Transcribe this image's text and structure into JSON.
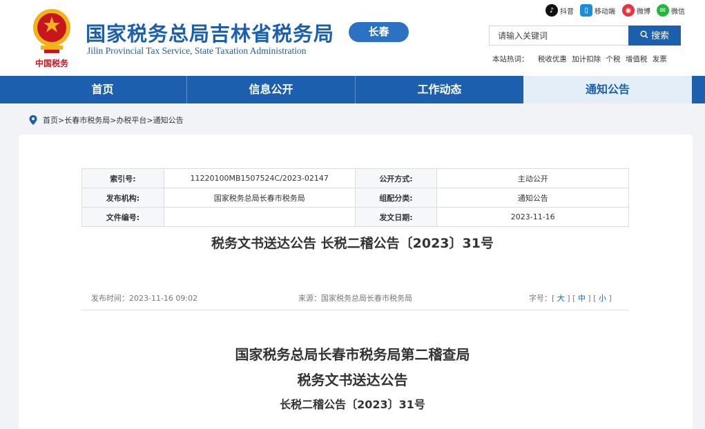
{
  "header": {
    "title": "国家税务总局吉林省税务局",
    "subtitle": "Jilin Provincial Tax Service, State Taxation Administration",
    "city_badge": "长春",
    "emblem_caption": "中国税务"
  },
  "social": [
    {
      "icon": "douyin-icon",
      "label": "抖音",
      "color": "#111111"
    },
    {
      "icon": "mobile-icon",
      "label": "移动端",
      "color": "#1a8fd8"
    },
    {
      "icon": "weibo-icon",
      "label": "微博",
      "color": "#e6333a"
    },
    {
      "icon": "wechat-icon",
      "label": "微信",
      "color": "#20b93b"
    }
  ],
  "search": {
    "placeholder": "请输入关键词",
    "button_label": "搜索"
  },
  "hot_keywords": {
    "label": "本站热词：",
    "items": [
      "税收优惠",
      "加计扣除",
      "个税",
      "增值税",
      "发票"
    ]
  },
  "nav": {
    "items": [
      "首页",
      "信息公开",
      "工作动态",
      "通知公告"
    ],
    "active_index": 3
  },
  "breadcrumb": [
    "首页",
    "长春市税务局",
    "办税平台",
    "通知公告"
  ],
  "meta_table": {
    "index_label": "索引号:",
    "index_value": "11220100MB1507524C/2023-02147",
    "public_mode_label": "公开方式:",
    "public_mode_value": "主动公开",
    "publisher_label": "发布机构:",
    "publisher_value": "国家税务总局长春市税务局",
    "category_label": "组配分类:",
    "category_value": "通知公告",
    "doc_no_label": "文件编号:",
    "doc_no_value": "",
    "date_label": "发文日期:",
    "date_value": "2023-11-16"
  },
  "doc_title": "税务文书送达公告 长税二稽公告〔2023〕31号",
  "info": {
    "publish_time": "发布时间：2023-11-16 09:02",
    "source": "来源：国家税务总局长春市税务局",
    "font_size_label": "字号：",
    "font_sizes": [
      "大",
      "中",
      "小"
    ]
  },
  "body": {
    "heading1": "国家税务总局长春市税务局第二稽查局",
    "heading2": "税务文书送达公告",
    "heading3": "长税二稽公告〔2023〕31号"
  },
  "colors": {
    "brand_blue": "#1b5fae",
    "badge_blue": "#2b73c2",
    "nav_active_bg": "#e4eef9",
    "emblem_red": "#c8161d",
    "emblem_gold": "#f1b31c"
  }
}
